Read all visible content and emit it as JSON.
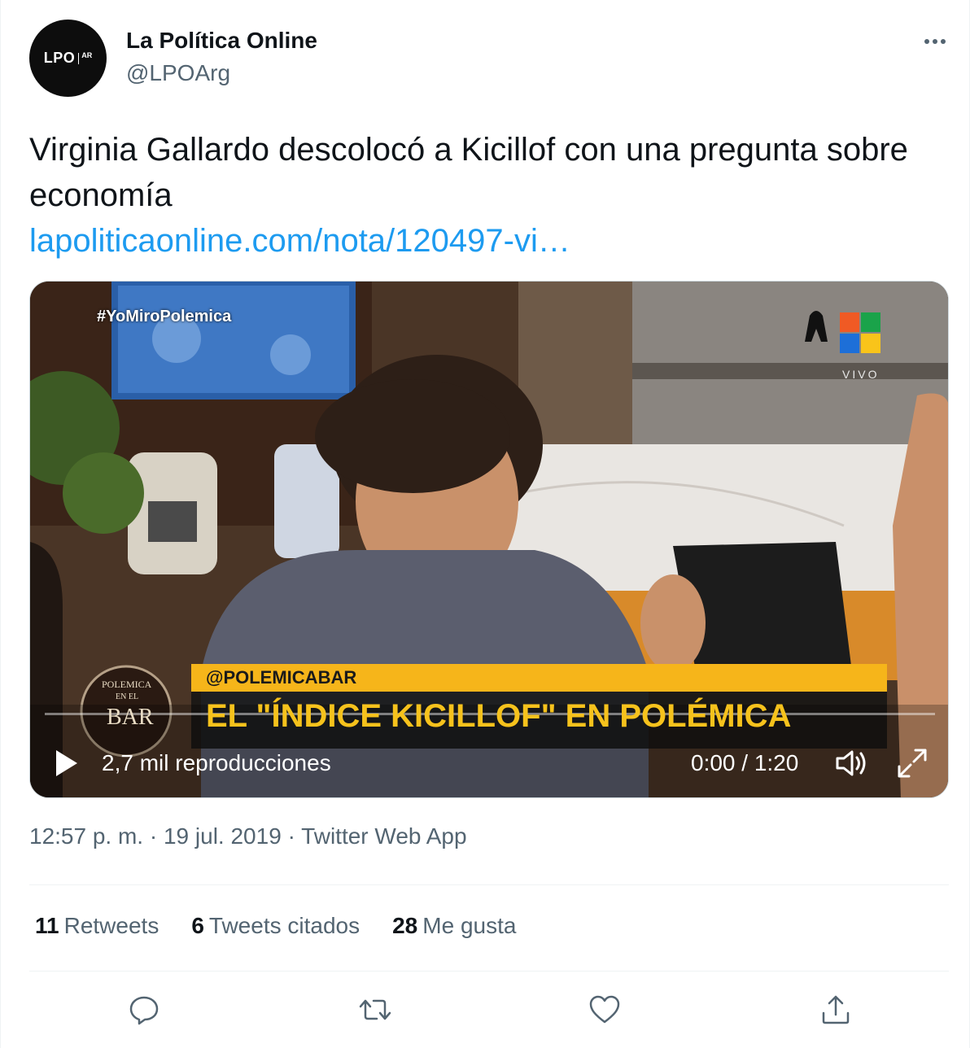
{
  "author": {
    "avatar_text": "LPO",
    "avatar_sub": "AR",
    "name": "La Política Online",
    "handle": "@LPOArg"
  },
  "tweet": {
    "text": "Virginia Gallardo descolocó a Kicillof con una pregunta sobre economía",
    "link": "lapoliticaonline.com/nota/120497-vi…"
  },
  "video": {
    "hashtag": "#YoMiroPolemica",
    "channel_tag": "VIVO",
    "lower_third_handle": "@POLEMICABAR",
    "lower_third_title": "EL \"ÍNDICE KICILLOF\" EN POLÉMICA",
    "show_logo_line1": "POLEMICA",
    "show_logo_line2": "EN EL",
    "show_logo_line3": "BAR",
    "views": "2,7 mil reproducciones",
    "time": "0:00 / 1:20",
    "progress": 0,
    "icons": [
      "play-icon",
      "volume-icon",
      "fullscreen-icon"
    ]
  },
  "meta": {
    "time": "12:57 p. m.",
    "date": "19 jul. 2019",
    "source": "Twitter Web App",
    "separator": "·"
  },
  "stats": [
    {
      "count": "11",
      "label": "Retweets"
    },
    {
      "count": "6",
      "label": "Tweets citados"
    },
    {
      "count": "28",
      "label": "Me gusta"
    }
  ],
  "actions": [
    "reply-icon",
    "retweet-icon",
    "like-icon",
    "share-icon"
  ],
  "colors": {
    "accent": "#1d9bf0",
    "secondary_text": "#536471",
    "primary_text": "#0f1419"
  }
}
